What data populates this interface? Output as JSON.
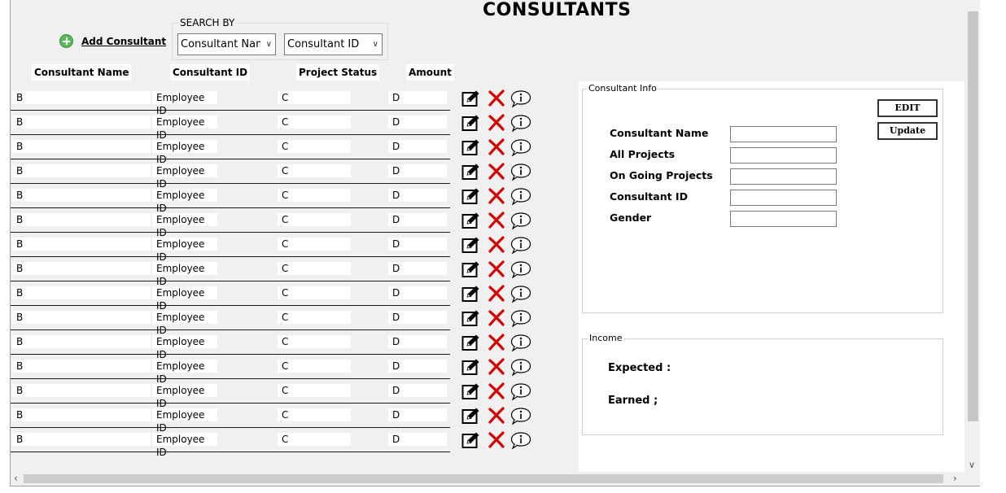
{
  "title": "CONSULTANTS",
  "add_button": {
    "label": "Add Consultant"
  },
  "search": {
    "legend": "SEARCH BY",
    "field_select": "Consultant Name",
    "value_select": "Consultant ID"
  },
  "columns": [
    "Consultant Name",
    "Consultant ID",
    "Project Status",
    "Amount"
  ],
  "rows": [
    {
      "name": "B",
      "id": "Employee ID",
      "status": "C",
      "amount": "D"
    },
    {
      "name": "B",
      "id": "Employee ID",
      "status": "C",
      "amount": "D"
    },
    {
      "name": "B",
      "id": "Employee ID",
      "status": "C",
      "amount": "D"
    },
    {
      "name": "B",
      "id": "Employee ID",
      "status": "C",
      "amount": "D"
    },
    {
      "name": "B",
      "id": "Employee ID",
      "status": "C",
      "amount": "D"
    },
    {
      "name": "B",
      "id": "Employee ID",
      "status": "C",
      "amount": "D"
    },
    {
      "name": "B",
      "id": "Employee ID",
      "status": "C",
      "amount": "D"
    },
    {
      "name": "B",
      "id": "Employee ID",
      "status": "C",
      "amount": "D"
    },
    {
      "name": "B",
      "id": "Employee ID",
      "status": "C",
      "amount": "D"
    },
    {
      "name": "B",
      "id": "Employee ID",
      "status": "C",
      "amount": "D"
    },
    {
      "name": "B",
      "id": "Employee ID",
      "status": "C",
      "amount": "D"
    },
    {
      "name": "B",
      "id": "Employee ID",
      "status": "C",
      "amount": "D"
    },
    {
      "name": "B",
      "id": "Employee ID",
      "status": "C",
      "amount": "D"
    },
    {
      "name": "B",
      "id": "Employee ID",
      "status": "C",
      "amount": "D"
    },
    {
      "name": "B",
      "id": "Employee ID",
      "status": "C",
      "amount": "D"
    }
  ],
  "row_actions": {
    "edit_icon": "edit-icon",
    "delete_icon": "delete-icon",
    "info_icon": "info-icon",
    "delete_color": "#d40000"
  },
  "consultant_info": {
    "legend": "Consultant Info",
    "edit_label": "EDIT",
    "update_label": "Update",
    "fields": [
      {
        "label": "Consultant Name",
        "value": ""
      },
      {
        "label": "All Projects",
        "value": ""
      },
      {
        "label": "On Going Projects",
        "value": ""
      },
      {
        "label": "Consultant ID",
        "value": ""
      },
      {
        "label": "Gender",
        "value": ""
      }
    ]
  },
  "income": {
    "legend": "Income",
    "expected_label": "Expected :",
    "earned_label": "Earned ;"
  },
  "colors": {
    "add_icon": "#5cb85c",
    "window_bg": "#f0f0f0"
  }
}
